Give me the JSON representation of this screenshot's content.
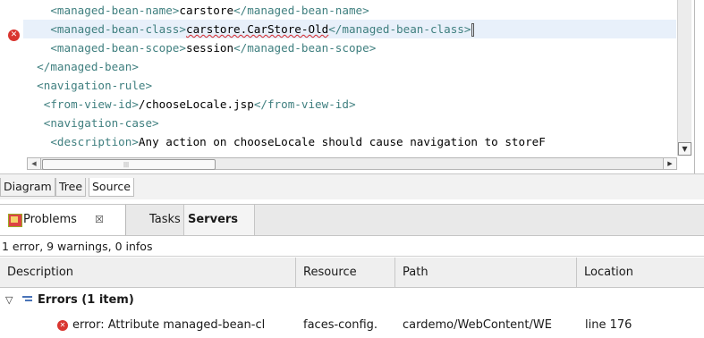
{
  "editor": {
    "lines": [
      [
        [
          "tag",
          "    <managed-bean-name>"
        ],
        [
          "txt",
          "carstore"
        ],
        [
          "tag",
          "</managed-bean-name>"
        ]
      ],
      [
        [
          "tag",
          "    <managed-bean-class>"
        ],
        [
          "err",
          "carstore.CarStore-Old"
        ],
        [
          "tag",
          "</managed-bean-class>"
        ]
      ],
      [
        [
          "tag",
          "    <managed-bean-scope>"
        ],
        [
          "txt",
          "session"
        ],
        [
          "tag",
          "</managed-bean-scope>"
        ]
      ],
      [
        [
          "tag",
          "  </managed-bean>"
        ]
      ],
      [
        [
          "tag",
          "  <navigation-rule>"
        ]
      ],
      [
        [
          "tag",
          "   <from-view-id>"
        ],
        [
          "txt",
          "/chooseLocale.jsp"
        ],
        [
          "tag",
          "</from-view-id>"
        ]
      ],
      [
        [
          "tag",
          "   <navigation-case>"
        ]
      ],
      [
        [
          "tag",
          "    <description>"
        ],
        [
          "txt",
          "Any action on chooseLocale should cause navigation to storeF"
        ]
      ]
    ],
    "error_marker_glyph": "✕"
  },
  "editor_tabs": [
    "Diagram",
    "Tree",
    "Source"
  ],
  "active_editor_tab": "Source",
  "problems_view": {
    "tabs": {
      "problems": "Problems",
      "problems_close": "☒",
      "tasks": "Tasks",
      "servers": "Servers"
    },
    "summary": "1 error, 9 warnings, 0 infos",
    "columns": {
      "description": "Description",
      "resource": "Resource",
      "path": "Path",
      "location": "Location"
    },
    "group": {
      "toggle": "▽",
      "label": "Errors (1 item)"
    },
    "error_row": {
      "description": "error: Attribute managed-bean-cl",
      "resource": "faces-config.",
      "path": "cardemo/WebContent/WE",
      "location": "line 176"
    }
  },
  "colors": {
    "tag": "#3f7f7f",
    "error": "#d9352f",
    "current_line": "#e8f0fa"
  }
}
